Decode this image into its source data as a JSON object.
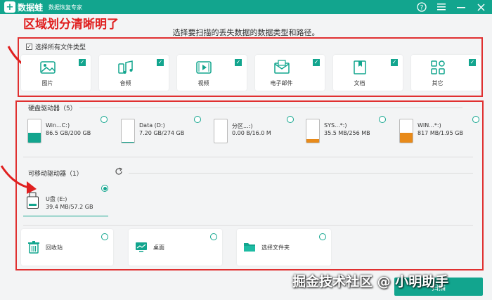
{
  "app": {
    "name": "数据蛙",
    "logo_glyph": "+",
    "subtitle": "数据恢复专家"
  },
  "window_controls": [
    "help-icon",
    "menu-icon",
    "minimize-icon",
    "close-icon"
  ],
  "annotation": "区域划分清晰明了",
  "instruction": "选择要扫描的丢失数据的数据类型和路径。",
  "select_all": {
    "label": "选择所有文件类型",
    "checked": true
  },
  "file_types": [
    {
      "label": "图片",
      "icon": "image-icon",
      "checked": true
    },
    {
      "label": "音频",
      "icon": "audio-icon",
      "checked": true
    },
    {
      "label": "视频",
      "icon": "video-icon",
      "checked": true
    },
    {
      "label": "电子邮件",
      "icon": "email-icon",
      "checked": true
    },
    {
      "label": "文档",
      "icon": "document-icon",
      "checked": true
    },
    {
      "label": "其它",
      "icon": "other-icon",
      "checked": true
    }
  ],
  "hard_drives": {
    "title": "硬盘驱动器（5）",
    "items": [
      {
        "name": "Win...C:)",
        "size": "86.5 GB/200 GB",
        "usage": 0.43,
        "fill_color": "#12a58e"
      },
      {
        "name": "Data (D:)",
        "size": "7.20 GB/274 GB",
        "usage": 0.03,
        "fill_color": "#12a58e"
      },
      {
        "name": "分区...:)",
        "size": "0.00  B/16.0 M",
        "usage": 0.0,
        "fill_color": "#e88a1a"
      },
      {
        "name": "SYS...*:)",
        "size": "35.5 MB/256 MB",
        "usage": 0.14,
        "fill_color": "#e88a1a"
      },
      {
        "name": "WIN...*:)",
        "size": "817 MB/1.95 GB",
        "usage": 0.42,
        "fill_color": "#e88a1a"
      }
    ]
  },
  "removable": {
    "title": "可移动驱动器（1）",
    "usb": {
      "name": "U盘 (E:)",
      "size": "39.4 MB/57.2 GB",
      "selected": true
    }
  },
  "locations": [
    {
      "label": "回收站",
      "icon": "recycle-bin-icon"
    },
    {
      "label": "桌面",
      "icon": "desktop-icon"
    },
    {
      "label": "选择文件夹",
      "icon": "folder-icon"
    }
  ],
  "next_button": "扫描",
  "watermark": "掘金技术社区 @ 小明助手",
  "colors": {
    "accent": "#12a58e",
    "annotation_red": "#e03030",
    "warning_orange": "#e88a1a"
  }
}
